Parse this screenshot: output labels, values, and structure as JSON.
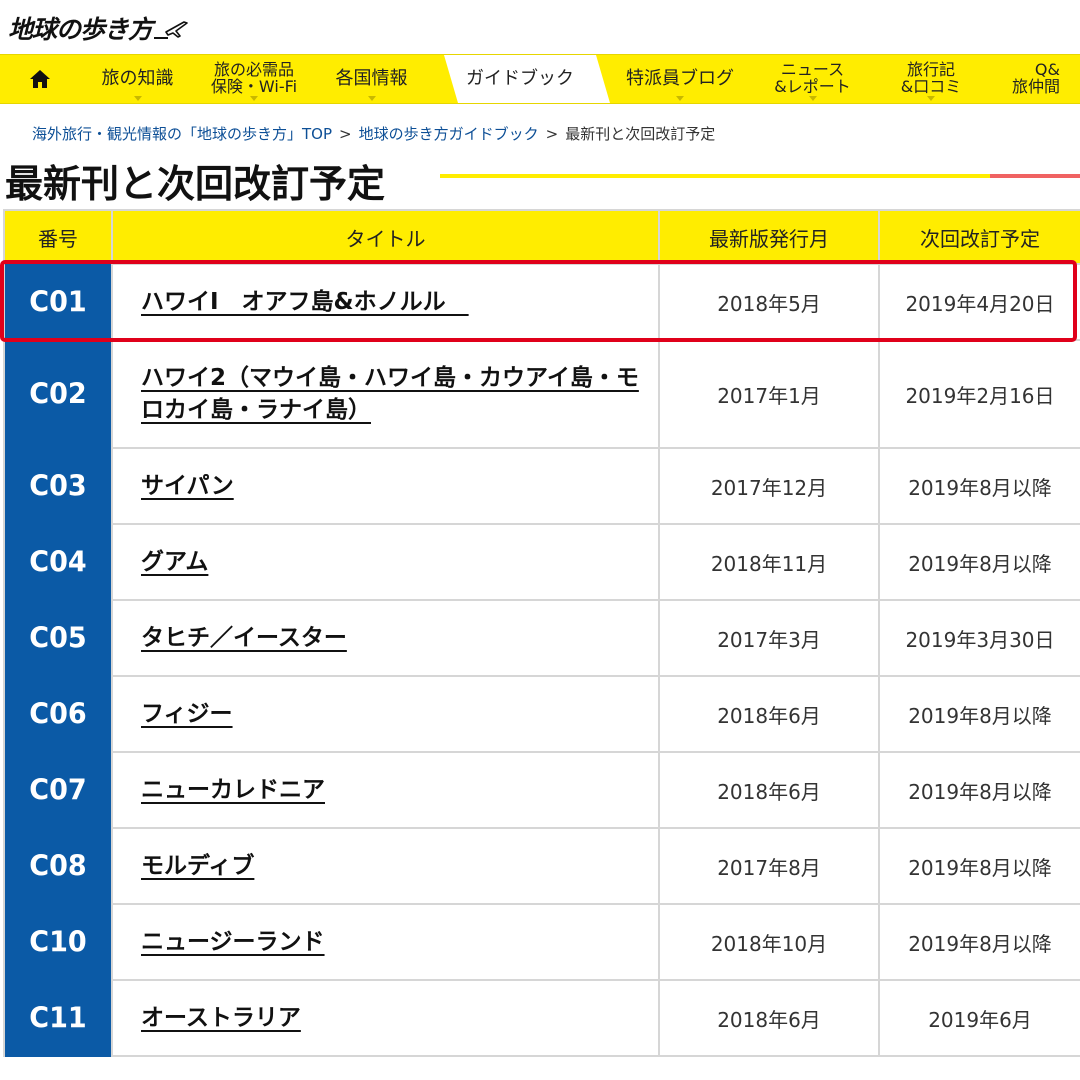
{
  "logo": {
    "text": "地球の歩き方"
  },
  "nav": {
    "home_icon": "home-icon",
    "items": [
      {
        "label": "旅の知識"
      },
      {
        "line1": "旅の必需品",
        "line2": "保険・Wi-Fi"
      },
      {
        "label": "各国情報"
      },
      {
        "label": "ガイドブック",
        "active": true
      },
      {
        "label": "特派員ブログ"
      },
      {
        "line1": "ニュース",
        "line2": "&レポート"
      },
      {
        "line1": "旅行記",
        "line2": "&口コミ"
      },
      {
        "line1": "Q&",
        "line2": "旅仲間"
      }
    ]
  },
  "breadcrumb": {
    "items": [
      "海外旅行・観光情報の「地球の歩き方」TOP",
      "地球の歩き方ガイドブック"
    ],
    "current": "最新刊と次回改訂予定",
    "separator": ">"
  },
  "page_title": "最新刊と次回改訂予定",
  "table": {
    "headers": [
      "番号",
      "タイトル",
      "最新版発行月",
      "次回改訂予定"
    ],
    "rows": [
      {
        "code": "C01",
        "title": "ハワイⅠ　オアフ島&ホノルル　",
        "published": "2018年5月",
        "next": "2019年4月20日"
      },
      {
        "code": "C02",
        "title": "ハワイ2（マウイ島・ハワイ島・カウアイ島・モロカイ島・ラナイ島）",
        "published": "2017年1月",
        "next": "2019年2月16日"
      },
      {
        "code": "C03",
        "title": "サイパン",
        "published": "2017年12月",
        "next": "2019年8月以降"
      },
      {
        "code": "C04",
        "title": "グアム",
        "published": "2018年11月",
        "next": "2019年8月以降"
      },
      {
        "code": "C05",
        "title": "タヒチ／イースター",
        "published": "2017年3月",
        "next": "2019年3月30日"
      },
      {
        "code": "C06",
        "title": "フィジー",
        "published": "2018年6月",
        "next": "2019年8月以降"
      },
      {
        "code": "C07",
        "title": "ニューカレドニア",
        "published": "2018年6月",
        "next": "2019年8月以降"
      },
      {
        "code": "C08",
        "title": "モルディブ",
        "published": "2017年8月",
        "next": "2019年8月以降"
      },
      {
        "code": "C10",
        "title": "ニュージーランド",
        "published": "2018年10月",
        "next": "2019年8月以降"
      },
      {
        "code": "C11",
        "title": "オーストラリア",
        "published": "2018年6月",
        "next": "2019年6月"
      }
    ]
  },
  "colors": {
    "nav_bg": "#ffed00",
    "code_bg": "#0b5aa6",
    "highlight": "#e0001a",
    "accent_red": "#f06262"
  }
}
